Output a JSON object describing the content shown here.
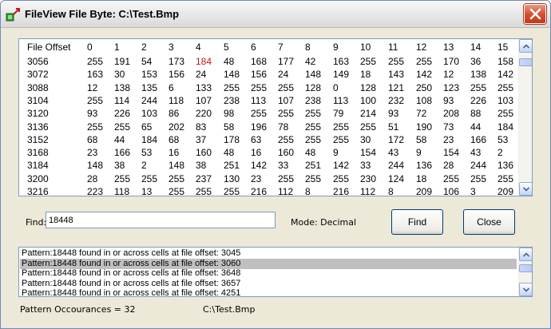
{
  "window": {
    "title": "FileView File Byte: C:\\Test.Bmp"
  },
  "grid": {
    "columns": [
      "File Offset",
      "0",
      "1",
      "2",
      "3",
      "4",
      "5",
      "6",
      "7",
      "8",
      "9",
      "10",
      "11",
      "12",
      "13",
      "14",
      "15"
    ],
    "rows": [
      [
        "3056",
        "255",
        "191",
        "54",
        "173",
        "184",
        "48",
        "168",
        "177",
        "42",
        "163",
        "255",
        "255",
        "255",
        "170",
        "36",
        "158"
      ],
      [
        "3072",
        "163",
        "30",
        "153",
        "156",
        "24",
        "148",
        "156",
        "24",
        "148",
        "149",
        "18",
        "143",
        "142",
        "12",
        "138",
        "142"
      ],
      [
        "3088",
        "12",
        "138",
        "135",
        "6",
        "133",
        "255",
        "255",
        "255",
        "128",
        "0",
        "128",
        "121",
        "250",
        "123",
        "255",
        "255"
      ],
      [
        "3104",
        "255",
        "114",
        "244",
        "118",
        "107",
        "238",
        "113",
        "107",
        "238",
        "113",
        "100",
        "232",
        "108",
        "93",
        "226",
        "103"
      ],
      [
        "3120",
        "93",
        "226",
        "103",
        "86",
        "220",
        "98",
        "255",
        "255",
        "255",
        "79",
        "214",
        "93",
        "72",
        "208",
        "88",
        "255"
      ],
      [
        "3136",
        "255",
        "255",
        "65",
        "202",
        "83",
        "58",
        "196",
        "78",
        "255",
        "255",
        "255",
        "51",
        "190",
        "73",
        "44",
        "184"
      ],
      [
        "3152",
        "68",
        "44",
        "184",
        "68",
        "37",
        "178",
        "63",
        "255",
        "255",
        "255",
        "30",
        "172",
        "58",
        "23",
        "166",
        "53"
      ],
      [
        "3168",
        "23",
        "166",
        "53",
        "16",
        "160",
        "48",
        "16",
        "160",
        "48",
        "9",
        "154",
        "43",
        "9",
        "154",
        "43",
        "2"
      ],
      [
        "3184",
        "148",
        "38",
        "2",
        "148",
        "38",
        "251",
        "142",
        "33",
        "251",
        "142",
        "33",
        "244",
        "136",
        "28",
        "244",
        "136"
      ],
      [
        "3200",
        "28",
        "255",
        "255",
        "255",
        "237",
        "130",
        "23",
        "255",
        "255",
        "255",
        "230",
        "124",
        "18",
        "255",
        "255",
        "255"
      ],
      [
        "3216",
        "223",
        "118",
        "13",
        "255",
        "255",
        "255",
        "216",
        "112",
        "8",
        "216",
        "112",
        "8",
        "209",
        "106",
        "3",
        "209"
      ]
    ],
    "highlight": {
      "row": 0,
      "col": 5,
      "color": "#c0191e"
    }
  },
  "find": {
    "label": "Find:",
    "value": "18448",
    "mode_text": "Mode: Decimal",
    "find_button": "Find",
    "close_button": "Close"
  },
  "results": {
    "items": [
      "Pattern:18448 found in or across cells at file offset: 3045",
      "Pattern:18448 found in or across cells at file offset: 3060",
      "Pattern:18448 found in or across cells at file offset: 3648",
      "Pattern:18448 found in or across cells at file offset: 3657",
      "Pattern:18448 found in or across cells at file offset: 4251"
    ],
    "selected_index": 1
  },
  "status": {
    "count_text": "Pattern Occourances =  32",
    "file_text": "C:\\Test.Bmp"
  },
  "icons": [
    "app-icon",
    "close-icon",
    "scroll-up-icon",
    "scroll-down-icon"
  ]
}
